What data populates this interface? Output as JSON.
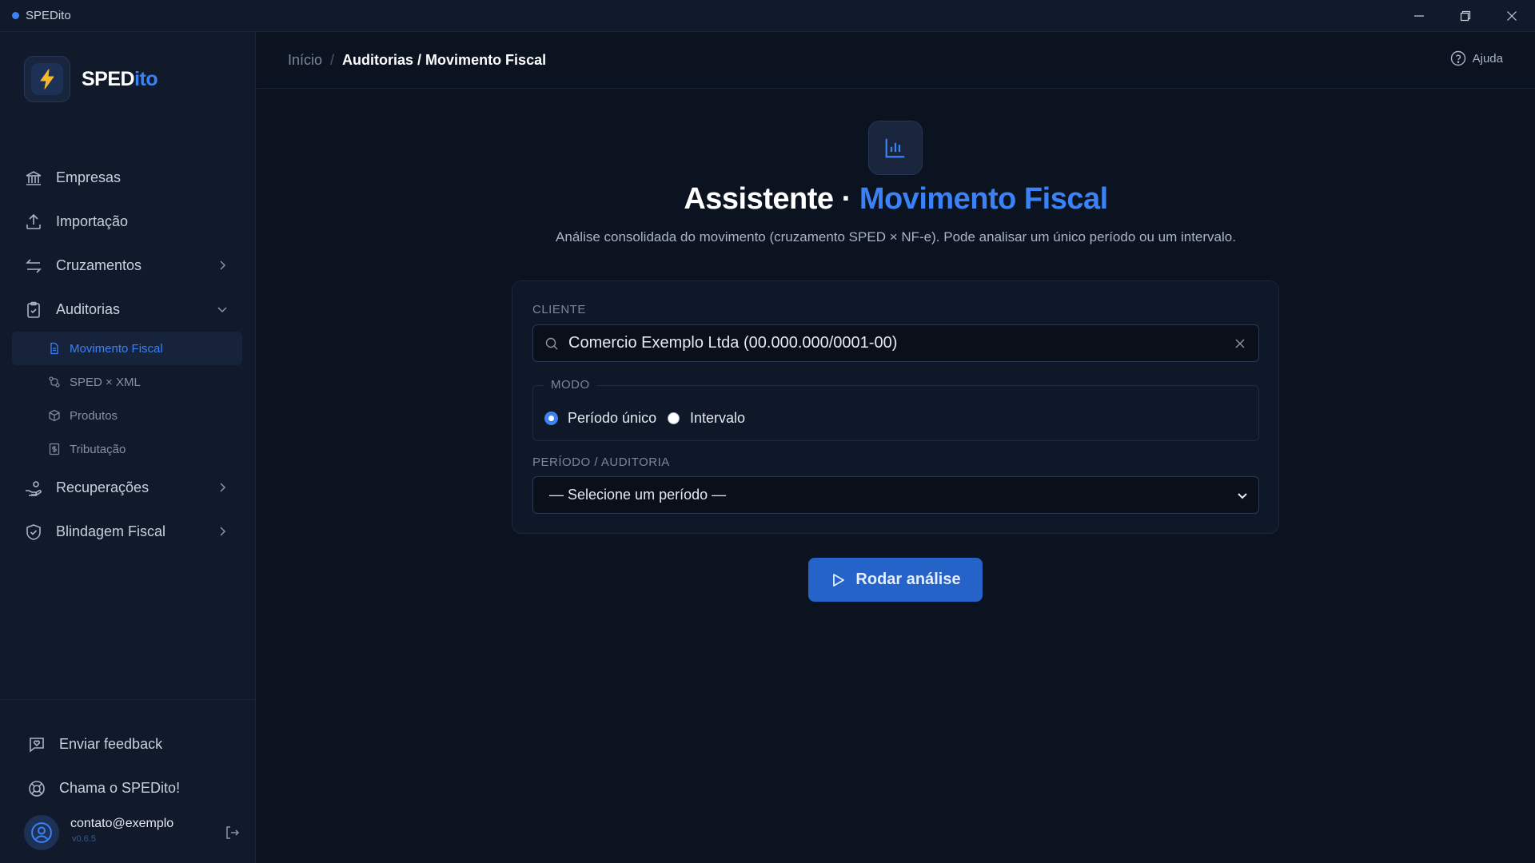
{
  "window": {
    "title": "SPEDito"
  },
  "brand": {
    "name_main": "SPED",
    "name_accent": "ito"
  },
  "sidebar": {
    "items": [
      {
        "label": "Empresas",
        "icon": "bank-icon"
      },
      {
        "label": "Importação",
        "icon": "upload-icon"
      },
      {
        "label": "Cruzamentos",
        "icon": "arrows-exchange-icon"
      },
      {
        "label": "Auditorias",
        "icon": "clipboard-check-icon",
        "expanded": true,
        "children": [
          {
            "label": "Movimento Fiscal",
            "icon": "document-icon",
            "active": true
          },
          {
            "label": "SPED × XML",
            "icon": "git-compare-icon"
          },
          {
            "label": "Produtos",
            "icon": "package-icon"
          },
          {
            "label": "Tributação",
            "icon": "receipt-icon"
          }
        ]
      },
      {
        "label": "Recuperações",
        "icon": "hand-coins-icon"
      },
      {
        "label": "Blindagem Fiscal",
        "icon": "shield-check-icon"
      }
    ],
    "footer": {
      "feedback_label": "Enviar feedback",
      "support_label": "Chama o SPEDito!",
      "user_email": "contato@exemplo",
      "version": "v0.6.5"
    }
  },
  "header": {
    "breadcrumb_home": "Início",
    "breadcrumb_separator": "/",
    "breadcrumb_current": "Auditorias / Movimento Fiscal",
    "help_label": "Ajuda"
  },
  "main": {
    "title_main": "Assistente · ",
    "title_accent": "Movimento Fiscal",
    "subtitle": "Análise consolidada do movimento (cruzamento SPED × NF-e). Pode analisar um único período ou um intervalo.",
    "form": {
      "client_label": "CLIENTE",
      "client_value": "Comercio Exemplo Ltda (00.000.000/0001-00)",
      "mode_label": "MODO",
      "mode_options": [
        {
          "label": "Período único",
          "selected": true
        },
        {
          "label": "Intervalo",
          "selected": false
        }
      ],
      "period_label": "PERÍODO / AUDITORIA",
      "period_value": "— Selecione um período —"
    },
    "run_button": "Rodar análise"
  },
  "colors": {
    "accent": "#3b82f6",
    "background": "#0b1220",
    "sidebar": "#111a2b",
    "button": "#2563c9"
  }
}
